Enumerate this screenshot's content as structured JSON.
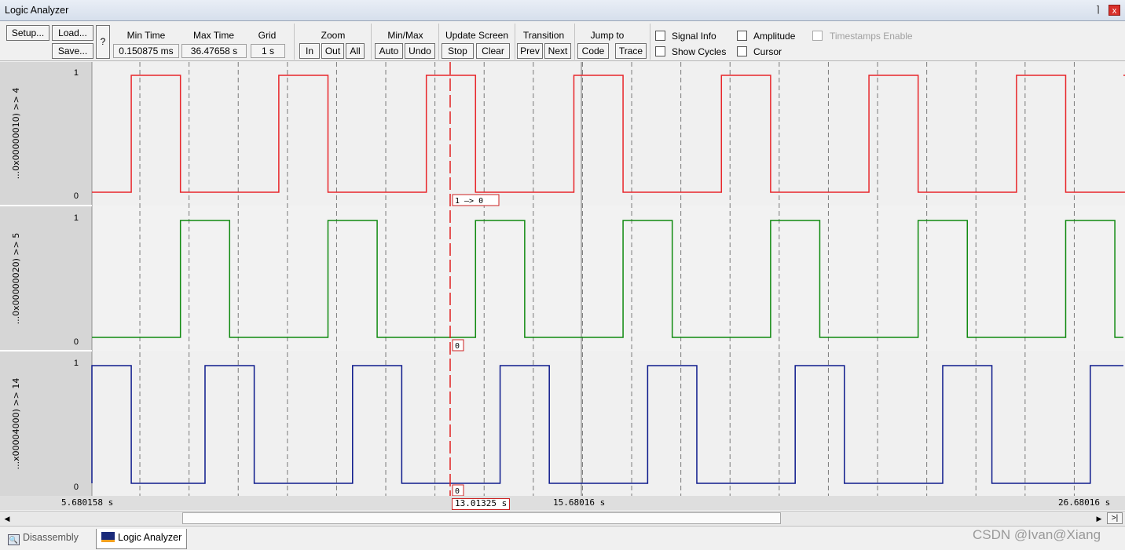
{
  "window": {
    "title": "Logic Analyzer",
    "pin_icon": "pin-icon",
    "close_label": "x"
  },
  "toolbar": {
    "setup": "Setup...",
    "load": "Load...",
    "save": "Save...",
    "help": "?",
    "min_time_label": "Min Time",
    "min_time_value": "0.150875 ms",
    "max_time_label": "Max Time",
    "max_time_value": "36.47658 s",
    "grid_label": "Grid",
    "grid_value": "1 s",
    "zoom_label": "Zoom",
    "zoom_in": "In",
    "zoom_out": "Out",
    "zoom_all": "All",
    "minmax_label": "Min/Max",
    "minmax_auto": "Auto",
    "minmax_undo": "Undo",
    "update_label": "Update Screen",
    "update_stop": "Stop",
    "update_clear": "Clear",
    "transition_label": "Transition",
    "transition_prev": "Prev",
    "transition_next": "Next",
    "jump_label": "Jump to",
    "jump_code": "Code",
    "jump_trace": "Trace",
    "signal_info": "Signal Info",
    "amplitude": "Amplitude",
    "timestamps_enable": "Timestamps Enable",
    "show_cycles": "Show Cycles",
    "cursor": "Cursor"
  },
  "signals": [
    {
      "label": "...0x00000010) >> 4",
      "high": "1",
      "low": "0",
      "color": "#e8262a",
      "cursor_value": "1 —> 0",
      "transitions": [
        0.8,
        1.8,
        3.8,
        4.8,
        6.8,
        7.8,
        9.8,
        10.8,
        12.8,
        13.8,
        15.8,
        16.8,
        18.8,
        19.8,
        21.8
      ]
    },
    {
      "label": "...0x00000020) >> 5",
      "high": "1",
      "low": "0",
      "color": "#108a10",
      "cursor_value": "0",
      "transitions": [
        1.8,
        2.8,
        4.8,
        5.8,
        7.8,
        8.8,
        10.8,
        11.8,
        13.8,
        14.8,
        16.8,
        17.8,
        19.8,
        20.8
      ]
    },
    {
      "label": "...x00004000) >> 14",
      "high": "1",
      "low": "0",
      "color": "#0d1a8c",
      "cursor_value": "0",
      "transitions": [
        0.0,
        0.8,
        2.3,
        3.3,
        5.3,
        6.3,
        8.3,
        9.3,
        11.3,
        12.3,
        14.3,
        15.3,
        17.3,
        18.3,
        20.3
      ]
    }
  ],
  "time_axis": {
    "left": "5.680158 s",
    "cursor": "13.01325 s",
    "mid": "15.68016 s",
    "right": "26.68016 s"
  },
  "tabs": [
    {
      "label": "Disassembly",
      "icon": "disassembly-icon"
    },
    {
      "label": "Logic Analyzer",
      "icon": "logic-analyzer-icon"
    }
  ],
  "watermark": "CSDN @Ivan@Xiang"
}
